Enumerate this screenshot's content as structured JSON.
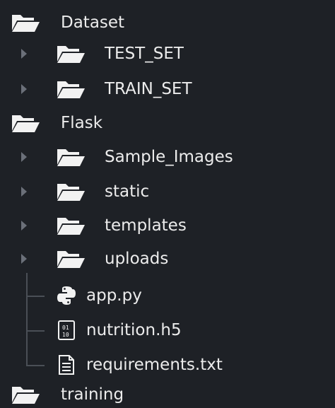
{
  "tree": {
    "dataset": {
      "label": "Dataset",
      "children": {
        "test_set": "TEST_SET",
        "train_set": "TRAIN_SET"
      }
    },
    "flask": {
      "label": "Flask",
      "children": {
        "sample_images": "Sample_Images",
        "static": "static",
        "templates": "templates",
        "uploads": "uploads",
        "app_py": "app.py",
        "nutrition_h5": "nutrition.h5",
        "requirements_txt": "requirements.txt"
      }
    },
    "training": {
      "label": "training"
    }
  },
  "colors": {
    "background": "#1e2126",
    "folder": "#f2f2f2",
    "text": "#ececec",
    "chevron": "#6b7079",
    "guide": "#4a4f56"
  },
  "icons": {
    "folder": "folder-open-icon",
    "python": "python-icon",
    "binary": "binary-file-icon",
    "text": "text-file-icon",
    "chevron": "chevron-right-icon"
  }
}
